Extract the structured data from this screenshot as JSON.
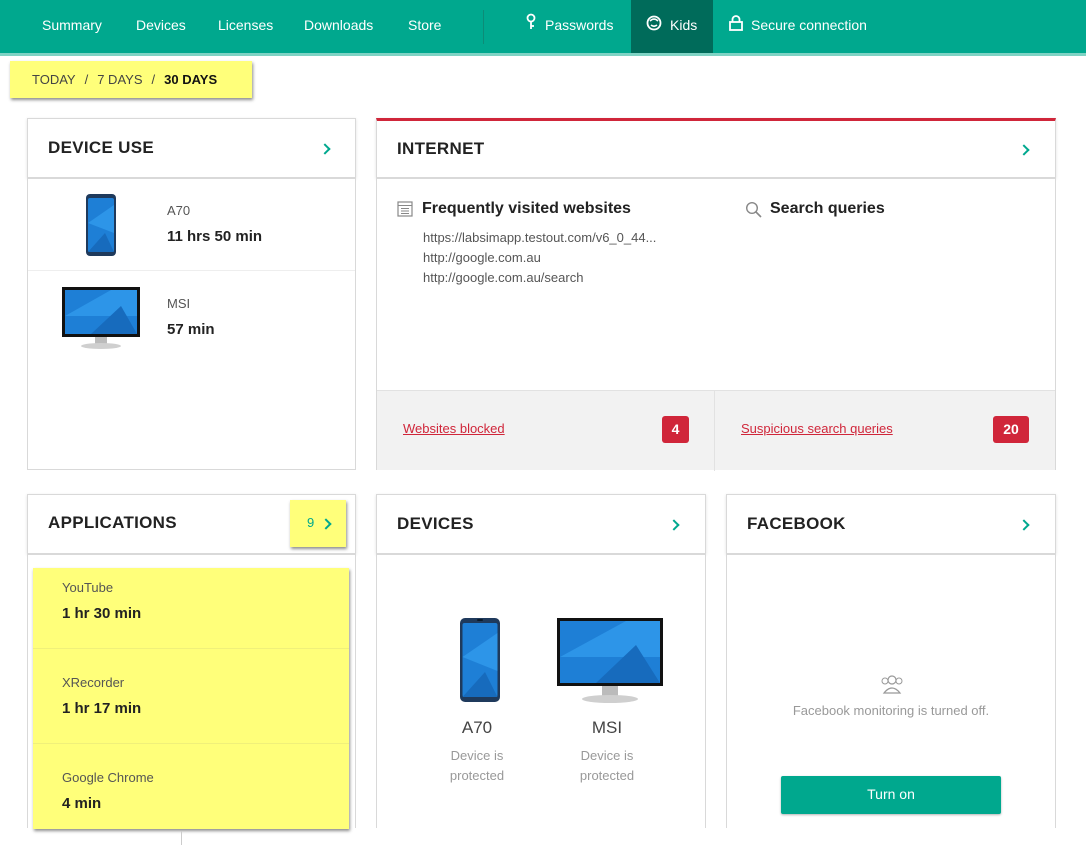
{
  "nav": {
    "items": [
      "Summary",
      "Devices",
      "Licenses",
      "Downloads",
      "Store"
    ],
    "passwords": "Passwords",
    "kids": "Kids",
    "secure": "Secure connection"
  },
  "period": {
    "today": "TODAY",
    "week": "7 DAYS",
    "month": "30 DAYS",
    "selected": "30 DAYS"
  },
  "device_use": {
    "title": "DEVICE USE",
    "devices": [
      {
        "name": "A70",
        "time": "11 hrs 50 min",
        "icon": "phone-icon"
      },
      {
        "name": "MSI",
        "time": "57 min",
        "icon": "monitor-icon"
      }
    ]
  },
  "internet": {
    "title": "INTERNET",
    "websites_title": "Frequently visited websites",
    "sites": [
      "https://labsimapp.testout.com/v6_0_44...",
      "http://google.com.au",
      "http://google.com.au/search"
    ],
    "search_title": "Search queries",
    "blocked_label": "Websites blocked",
    "blocked_count": "4",
    "suspicious_label": "Suspicious search queries",
    "suspicious_count": "20"
  },
  "applications": {
    "title": "APPLICATIONS",
    "count": "9",
    "apps": [
      {
        "name": "YouTube",
        "time": "1 hr 30 min"
      },
      {
        "name": "XRecorder",
        "time": "1 hr 17 min"
      },
      {
        "name": "Google Chrome",
        "time": "4 min"
      }
    ]
  },
  "devices": {
    "title": "DEVICES",
    "list": [
      {
        "name": "A70",
        "status": "Device is protected"
      },
      {
        "name": "MSI",
        "status": "Device is protected"
      }
    ]
  },
  "facebook": {
    "title": "FACEBOOK",
    "message": "Facebook monitoring is turned off.",
    "button": "Turn on"
  },
  "colors": {
    "accent": "#00a88e",
    "nav_active": "#006b5a",
    "alert": "#d0263a",
    "highlight": "#ffff7a"
  }
}
